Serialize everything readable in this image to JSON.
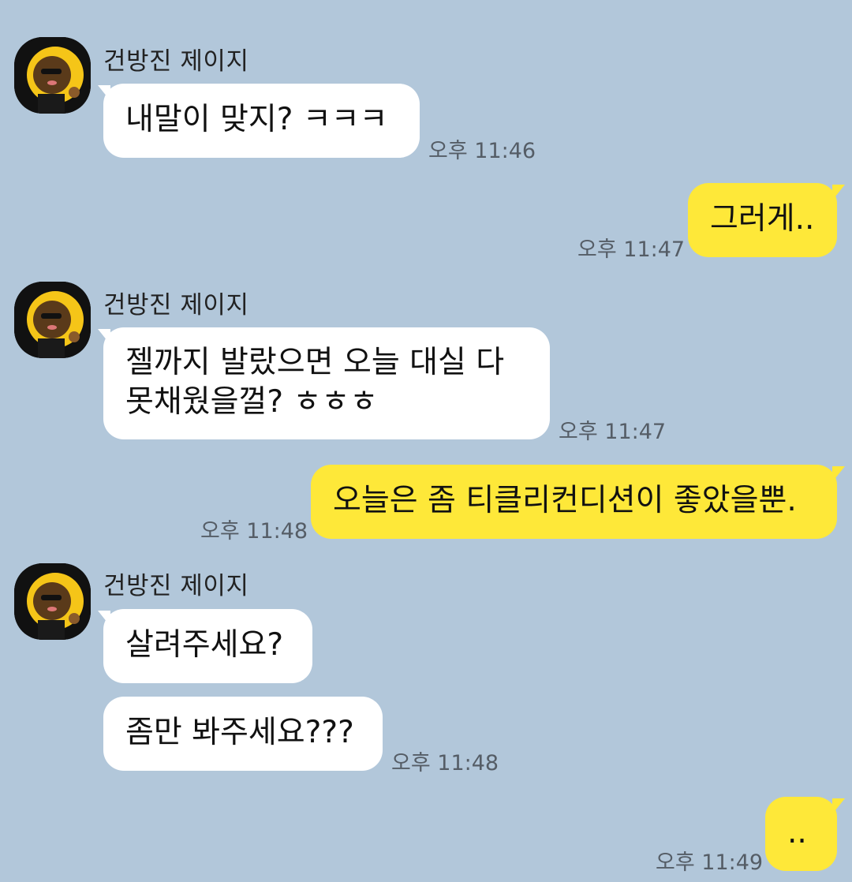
{
  "conversation": {
    "sender_name": "건방진 제이지",
    "messages": [
      {
        "direction": "incoming",
        "text": "내말이 맞지? ㅋㅋㅋ",
        "time": "오후 11:46"
      },
      {
        "direction": "outgoing",
        "text": "그러게..",
        "time": "오후 11:47"
      },
      {
        "direction": "incoming",
        "lines": [
          "젤까지 발랐으면 오늘 대실 다",
          "못채웠을껄? ㅎㅎㅎ"
        ],
        "time": "오후 11:47"
      },
      {
        "direction": "outgoing",
        "text": "오늘은 좀 티클리컨디션이 좋았을뿐.",
        "time": "오후 11:48"
      },
      {
        "direction": "incoming",
        "text": "살려주세요?",
        "time": ""
      },
      {
        "direction": "incoming",
        "text": "좀만 봐주세요???",
        "time": "오후 11:48"
      },
      {
        "direction": "outgoing",
        "text": "..",
        "time": "오후 11:49"
      }
    ]
  },
  "colors": {
    "background": "#b2c7da",
    "incoming_bubble": "#ffffff",
    "outgoing_bubble": "#fee839",
    "timestamp": "#555d66"
  },
  "icons": {
    "avatar": "profile-avatar-icon"
  }
}
